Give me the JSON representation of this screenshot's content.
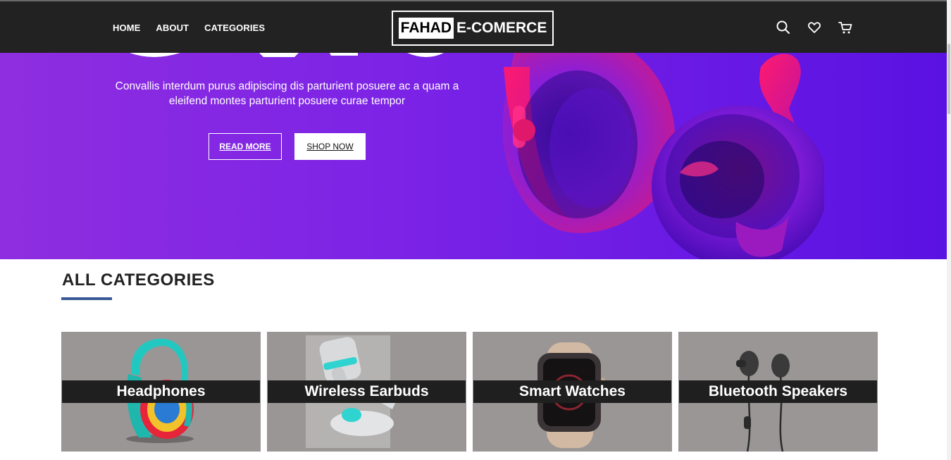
{
  "nav": {
    "links": [
      "HOME",
      "ABOUT",
      "CATEGORIES"
    ],
    "logo_box": "FAHAD",
    "logo_rest": "E-COMERCE",
    "icons": [
      "search-icon",
      "heart-icon",
      "cart-icon"
    ]
  },
  "hero": {
    "description": "Convallis interdum purus adipiscing dis parturient posuere ac a quam a eleifend montes parturient posuere curae tempor",
    "read_more": "READ MORE",
    "shop_now": "SHOP NOW"
  },
  "categories": {
    "title": "ALL CATEGORIES",
    "items": [
      {
        "label": "Headphones"
      },
      {
        "label": "Wireless Earbuds"
      },
      {
        "label": "Smart Watches"
      },
      {
        "label": "Bluetooth Speakers"
      }
    ]
  },
  "colors": {
    "navbar": "#222222",
    "hero_start": "#8f2ee0",
    "hero_end": "#5a12e2",
    "accent_underline": "#3b5998",
    "card_bg": "#9a9696"
  }
}
